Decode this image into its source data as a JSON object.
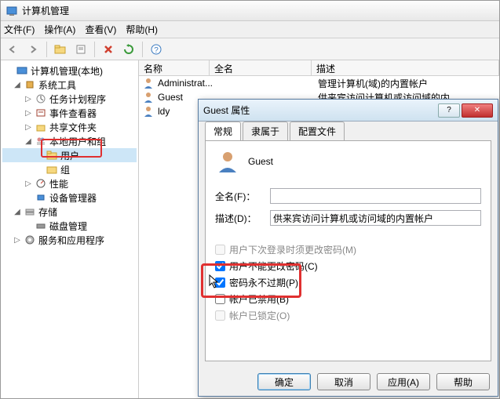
{
  "window": {
    "title": "计算机管理"
  },
  "menu": {
    "file": "文件(F)",
    "action": "操作(A)",
    "view": "查看(V)",
    "help": "帮助(H)"
  },
  "tree": {
    "root": "计算机管理(本地)",
    "systools": "系统工具",
    "scheduler": "任务计划程序",
    "eventviewer": "事件查看器",
    "sharedfolders": "共享文件夹",
    "localusers": "本地用户和组",
    "users": "用户",
    "groups": "组",
    "perf": "性能",
    "devmgr": "设备管理器",
    "storage": "存储",
    "diskmgmt": "磁盘管理",
    "services": "服务和应用程序"
  },
  "list": {
    "cols": {
      "name": "名称",
      "fullname": "全名",
      "desc": "描述"
    },
    "rows": [
      {
        "name": "Administrat...",
        "fullname": "",
        "desc": "管理计算机(域)的内置帐户"
      },
      {
        "name": "Guest",
        "fullname": "",
        "desc": "供来宾访问计算机或访问域的内..."
      },
      {
        "name": "ldy",
        "fullname": "",
        "desc": ""
      }
    ]
  },
  "dialog": {
    "title": "Guest 属性",
    "tabs": {
      "general": "常规",
      "memberof": "隶属于",
      "profile": "配置文件"
    },
    "username": "Guest",
    "fullname_label": "全名(F)：",
    "fullname_value": "",
    "desc_label": "描述(D)：",
    "desc_value": "供来宾访问计算机或访问域的内置帐户",
    "chk_mustchange": "用户下次登录时须更改密码(M)",
    "chk_cannotchange": "用户不能更改密码(C)",
    "chk_neverexpire": "密码永不过期(P)",
    "chk_disabled": "帐户已禁用(B)",
    "chk_locked": "帐户已锁定(O)",
    "btn_ok": "确定",
    "btn_cancel": "取消",
    "btn_apply": "应用(A)",
    "btn_help": "帮助"
  }
}
